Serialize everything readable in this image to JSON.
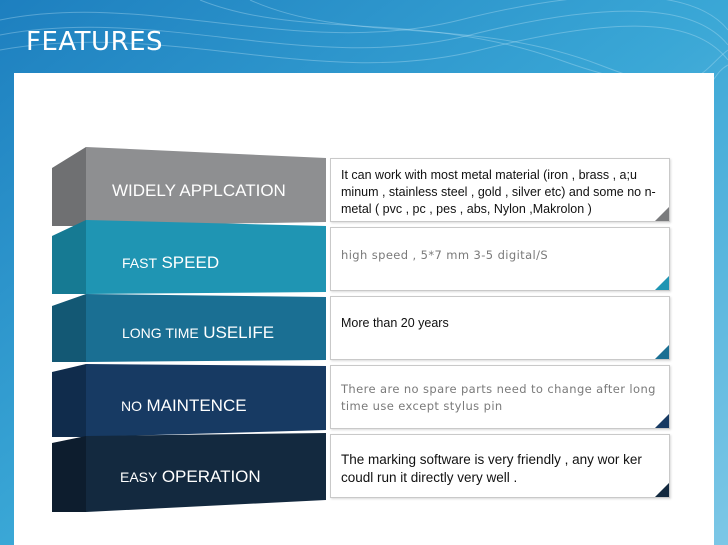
{
  "page": {
    "title": "FEATURES"
  },
  "features": [
    {
      "label_small": "",
      "label_large": "WIDELY APPLCATION",
      "description": "It can work with most metal material (iron , brass , a;u minum , stainless steel , gold , silver etc) and some no n-metal (  pvc , pc , pes , abs, Nylon ,Makrolon )",
      "front_color": "#8e8f91",
      "side_color": "#6f7072",
      "corner_color": "#7a7b7d"
    },
    {
      "label_small": "FAST",
      "label_large": "SPEED",
      "description": "high speed , 5*7 mm 3-5 digital/S",
      "front_color": "#1f95b3",
      "side_color": "#167a93",
      "corner_color": "#1f95b3"
    },
    {
      "label_small": "LONG TIME",
      "label_large": "USELIFE",
      "description": "More than 20 years",
      "front_color": "#1a6f93",
      "side_color": "#135874",
      "corner_color": "#1a6f93"
    },
    {
      "label_small": "NO",
      "label_large": "MAINTENCE",
      "description": "There are no spare parts need to change after long time use except stylus pin",
      "front_color": "#173a63",
      "side_color": "#102c4c",
      "corner_color": "#173a63"
    },
    {
      "label_small": "EASY",
      "label_large": "OPERATION",
      "description": "The marking software is very friendly , any wor ker coudl run it directly very well .",
      "front_color": "#13293f",
      "side_color": "#0d1d2e",
      "corner_color": "#13293f"
    }
  ]
}
